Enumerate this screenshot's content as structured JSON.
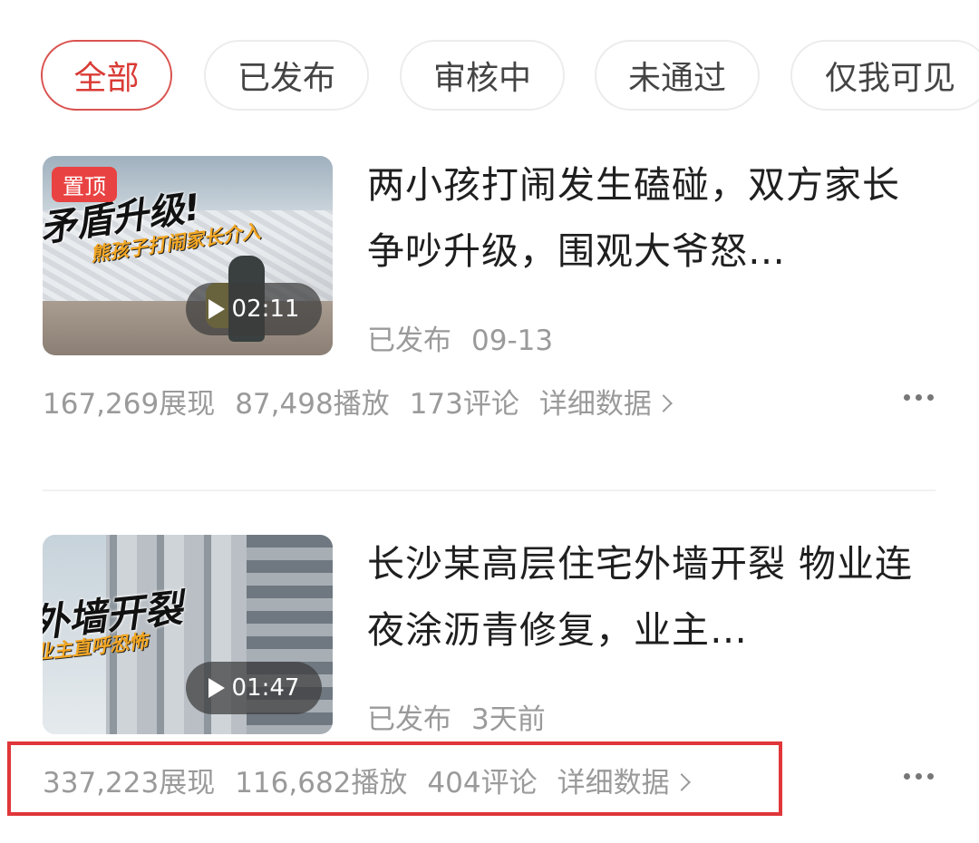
{
  "tabs": [
    {
      "label": "全部",
      "active": true
    },
    {
      "label": "已发布",
      "active": false
    },
    {
      "label": "审核中",
      "active": false
    },
    {
      "label": "未通过",
      "active": false
    },
    {
      "label": "仅我可见",
      "active": false
    }
  ],
  "videos": [
    {
      "pin_badge": "置顶",
      "overlay_title": "矛盾升级!",
      "overlay_subtitle": "熊孩子打闹家长介入",
      "duration": "02:11",
      "title": "两小孩打闹发生磕碰，双方家长争吵升级，围观大爷怒…",
      "status": "已发布",
      "time": "09-13",
      "impressions": "167,269展现",
      "plays": "87,498播放",
      "comments": "173评论",
      "detail_link": "详细数据"
    },
    {
      "overlay_title": "外墙开裂",
      "overlay_subtitle": "业主直呼恐怖",
      "duration": "01:47",
      "title": "长沙某高层住宅外墙开裂 物业连夜涂沥青修复，业主…",
      "status": "已发布",
      "time": "3天前",
      "impressions": "337,223展现",
      "plays": "116,682播放",
      "comments": "404评论",
      "detail_link": "详细数据"
    }
  ],
  "colors": {
    "accent": "#d93b35",
    "highlight_box": "#e0363a",
    "muted_text": "#9a9a9a"
  },
  "icons": [
    "play-icon",
    "chevron-right-icon",
    "more-icon"
  ]
}
